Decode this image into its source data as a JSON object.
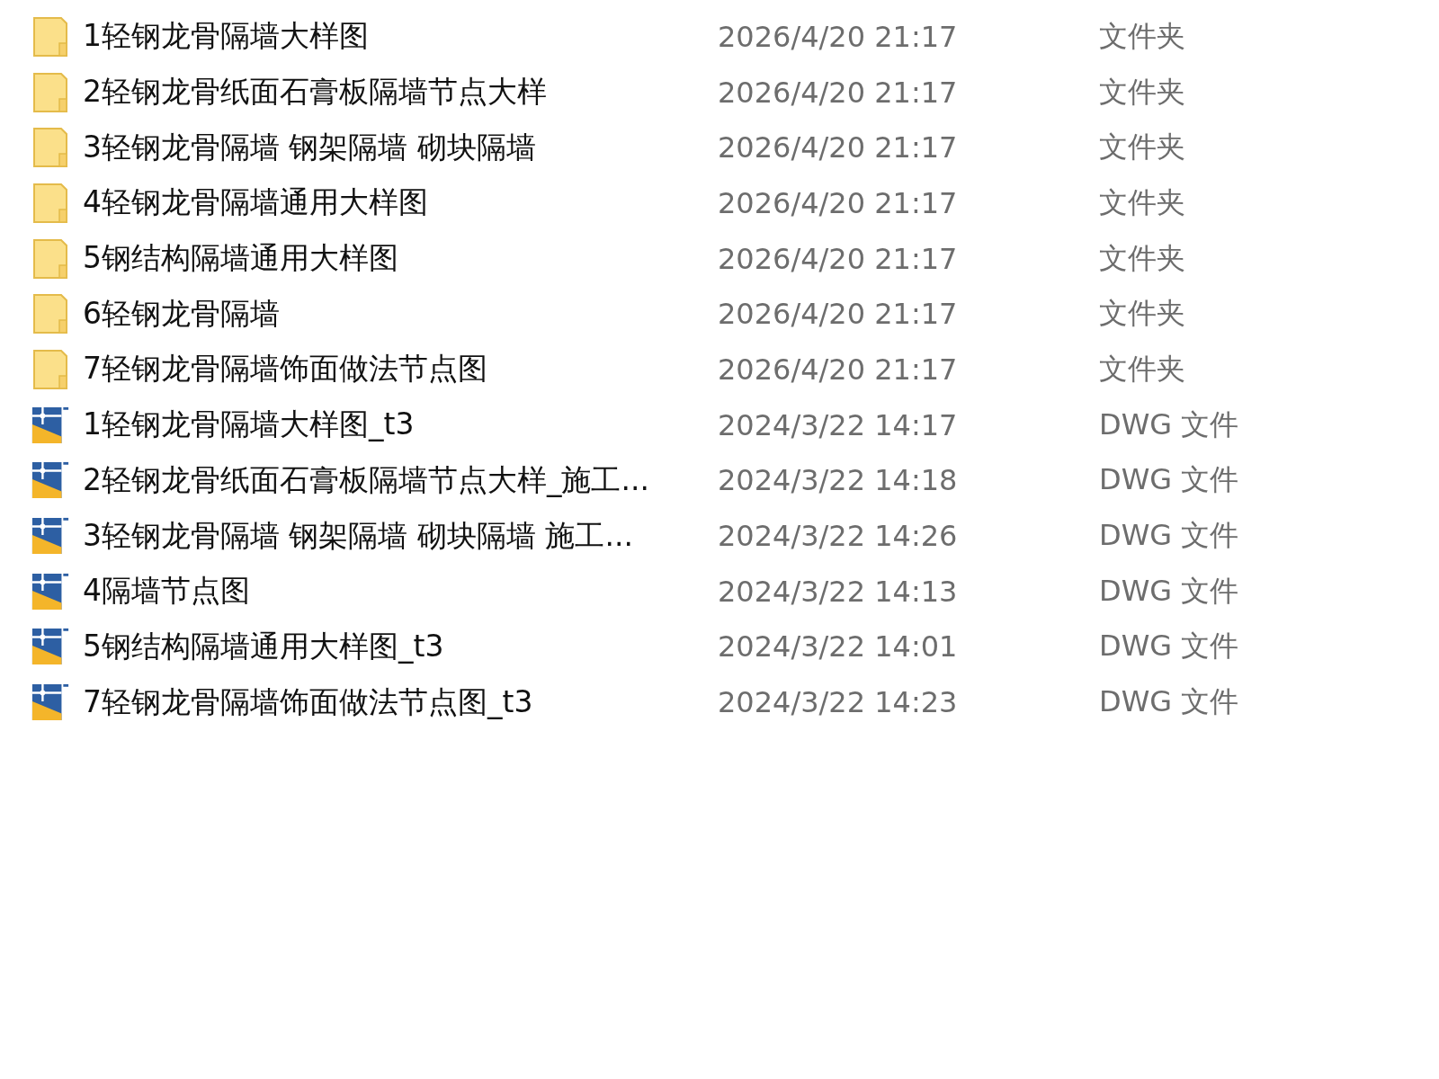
{
  "files": [
    {
      "kind": "folder",
      "name": "1轻钢龙骨隔墙大样图",
      "modified": "2026/4/20 21:17",
      "type": "文件夹"
    },
    {
      "kind": "folder",
      "name": "2轻钢龙骨纸面石膏板隔墙节点大样",
      "modified": "2026/4/20 21:17",
      "type": "文件夹"
    },
    {
      "kind": "folder",
      "name": "3轻钢龙骨隔墙 钢架隔墙 砌块隔墙",
      "modified": "2026/4/20 21:17",
      "type": "文件夹"
    },
    {
      "kind": "folder",
      "name": "4轻钢龙骨隔墙通用大样图",
      "modified": "2026/4/20 21:17",
      "type": "文件夹"
    },
    {
      "kind": "folder",
      "name": "5钢结构隔墙通用大样图",
      "modified": "2026/4/20 21:17",
      "type": "文件夹"
    },
    {
      "kind": "folder",
      "name": "6轻钢龙骨隔墙",
      "modified": "2026/4/20 21:17",
      "type": "文件夹"
    },
    {
      "kind": "folder",
      "name": "7轻钢龙骨隔墙饰面做法节点图",
      "modified": "2026/4/20 21:17",
      "type": "文件夹"
    },
    {
      "kind": "dwg",
      "name": "1轻钢龙骨隔墙大样图_t3",
      "modified": "2024/3/22 14:17",
      "type": "DWG 文件"
    },
    {
      "kind": "dwg",
      "name": "2轻钢龙骨纸面石膏板隔墙节点大样_施工...",
      "modified": "2024/3/22 14:18",
      "type": "DWG 文件"
    },
    {
      "kind": "dwg",
      "name": "3轻钢龙骨隔墙 钢架隔墙 砌块隔墙 施工...",
      "modified": "2024/3/22 14:26",
      "type": "DWG 文件"
    },
    {
      "kind": "dwg",
      "name": "4隔墙节点图",
      "modified": "2024/3/22 14:13",
      "type": "DWG 文件"
    },
    {
      "kind": "dwg",
      "name": "5钢结构隔墙通用大样图_t3",
      "modified": "2024/3/22 14:01",
      "type": "DWG 文件"
    },
    {
      "kind": "dwg",
      "name": "7轻钢龙骨隔墙饰面做法节点图_t3",
      "modified": "2024/3/22 14:23",
      "type": "DWG 文件"
    }
  ]
}
